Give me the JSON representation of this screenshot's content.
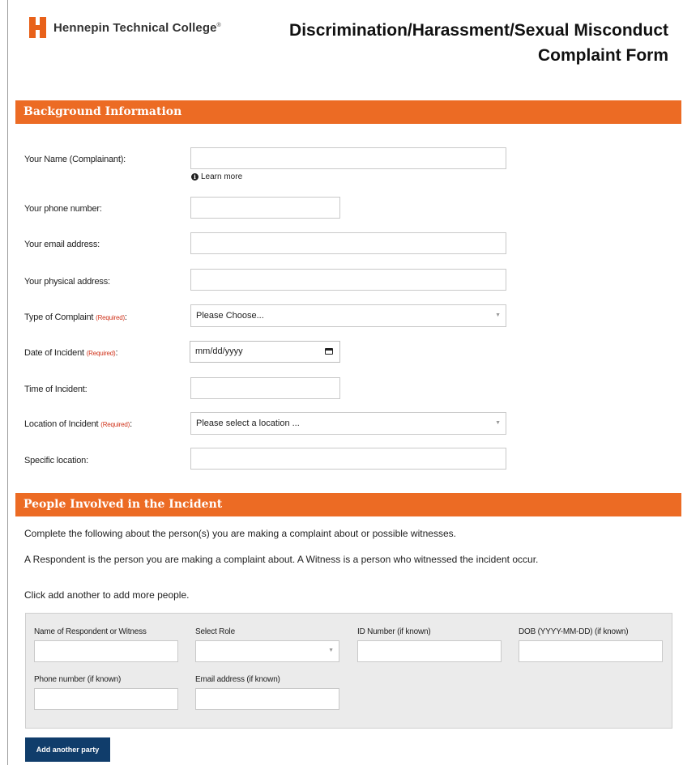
{
  "header": {
    "logo_text": "Hennepin Technical College",
    "logo_tm": "®",
    "title_line1": "Discrimination/Harassment/Sexual Misconduct",
    "title_line2": "Complaint Form",
    "brand_color": "#ec6b24"
  },
  "background": {
    "section_title": "Background Information",
    "name_label": "Your Name (Complainant):",
    "learn_more": "Learn more",
    "phone_label": "Your phone number:",
    "email_label": "Your email address:",
    "address_label": "Your physical address:",
    "complaint_type_label": "Type of Complaint",
    "complaint_type_value": "Please Choose...",
    "date_label": "Date of Incident",
    "date_placeholder": "mm/dd/yyyy",
    "time_label": "Time of Incident:",
    "location_label": "Location of Incident",
    "location_value": "Please select a location ...",
    "specific_location_label": "Specific location:",
    "required_text": "(Required)",
    "colon": ":"
  },
  "people": {
    "section_title": "People Involved in the Incident",
    "intro1": "Complete the following about the person(s) you are making a complaint about or possible witnesses.",
    "intro2": "A Respondent is the person you are making a complaint about. A Witness is a person who witnessed the incident occur.",
    "intro3": "Click add another to add more people.",
    "name_label": "Name of Respondent or Witness",
    "role_label": "Select Role",
    "id_label": "ID Number (if known)",
    "dob_label": "DOB (YYYY-MM-DD) (if known)",
    "phone_label": "Phone number (if known)",
    "email_label": "Email address (if known)",
    "add_button": "Add another party",
    "button_color": "#103d6b"
  },
  "icons": {
    "info": "info-circle-icon",
    "calendar": "calendar-icon",
    "dropdown": "chevron-down-icon"
  }
}
